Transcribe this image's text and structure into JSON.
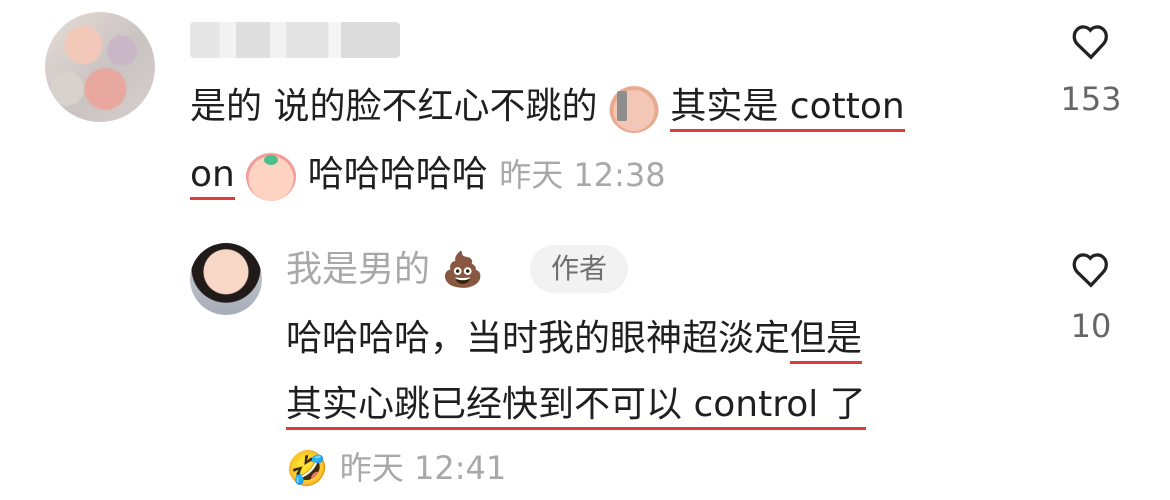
{
  "comments": [
    {
      "text_line1_plain": "是的 说的脸不红心不跳的",
      "text_line1_emoji": "face-with-wall-emoji",
      "text_line1_underlined": "其实是 cotton",
      "text_line2_underlined": "on",
      "text_line2_emoji": "crying-laughing-face-emoji",
      "text_line2_plain": "哈哈哈哈哈",
      "time": "昨天 12:38",
      "likes": "153"
    },
    {
      "author": "我是男的",
      "author_badge": "作者",
      "author_emoji": "💩",
      "text_line1_plain": "哈哈哈哈，当时我的眼神超淡定",
      "text_line1_underlined": "但是",
      "text_line2_underlined": "其实心跳已经快到不可以 control 了",
      "reaction_emoji": "🤣",
      "time": "昨天 12:41",
      "likes": "10"
    }
  ],
  "colors": {
    "underline": "#e03b3b",
    "meta": "#a8a8a8"
  }
}
